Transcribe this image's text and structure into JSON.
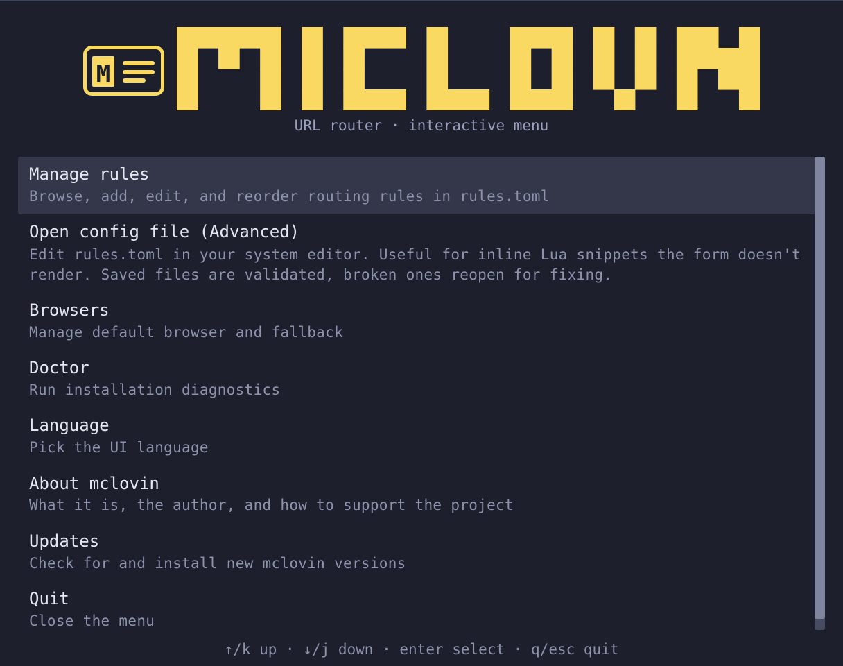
{
  "app": {
    "brand_name": "MCLOVIN",
    "badge_letter": "M",
    "subtitle": "URL router · interactive menu",
    "accent_color": "#f9d962"
  },
  "menu": {
    "selected_index": 0,
    "items": [
      {
        "title": "Manage rules",
        "description": "Browse, add, edit, and reorder routing rules in rules.toml"
      },
      {
        "title": "Open config file (Advanced)",
        "description": "Edit rules.toml in your system editor. Useful for inline Lua snippets the form doesn't render. Saved files are validated, broken ones reopen for fixing."
      },
      {
        "title": "Browsers",
        "description": "Manage default browser and fallback"
      },
      {
        "title": "Doctor",
        "description": "Run installation diagnostics"
      },
      {
        "title": "Language",
        "description": "Pick the UI language"
      },
      {
        "title": "About mclovin",
        "description": "What it is, the author, and how to support the project"
      },
      {
        "title": "Updates",
        "description": "Check for and install new mclovin versions"
      },
      {
        "title": "Quit",
        "description": "Close the menu"
      }
    ]
  },
  "scrollbar": {
    "visible_fraction": 0.98,
    "scroll_position": 0
  },
  "help": {
    "up": "↑/k up",
    "down": "↓/j down",
    "select": "enter select",
    "quit": "q/esc quit",
    "separator": " · "
  }
}
